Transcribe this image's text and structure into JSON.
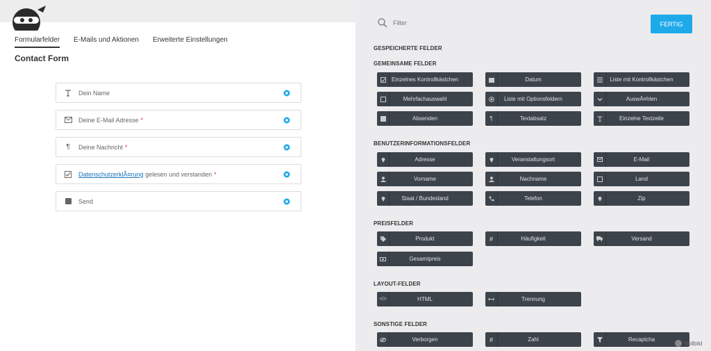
{
  "tabs": [
    "Formularfelder",
    "E-Mails und Aktionen",
    "Erweiterte Einstellungen"
  ],
  "form_title": "Contact Form",
  "fields": [
    {
      "label": "Dein Name",
      "icon": "text-icon",
      "required": ""
    },
    {
      "label": "Deine E-Mail Adresse",
      "icon": "envelope-icon",
      "required": "*"
    },
    {
      "label": "Deine Nachricht",
      "icon": "paragraph-icon",
      "required": "*"
    },
    {
      "link": "DatenschutzerklÃ¤rung",
      "label": " gelesen und verstanden",
      "icon": "checkbox-icon",
      "required": "*"
    },
    {
      "label": "Send",
      "icon": "square-icon",
      "required": ""
    }
  ],
  "filter_placeholder": "Filter",
  "done_label": "FERTIG",
  "sections": {
    "saved": "GESPEICHERTE FELDER",
    "common": "GEMEINSAME FELDER",
    "userinfo": "BENUTZERINFORMATIONSFELDER",
    "pricing": "PREISFELDER",
    "layout": "LAYOUT-FELDER",
    "misc": "SONSTIGE FELDER"
  },
  "common_fields": [
    "Einzelnes Kontrollkästchen",
    "Datum",
    "Liste mit Kontrollkästchen",
    "Mehrfachauswahl",
    "Liste mit Optionsfeldern",
    "AuswÃ¤hlen",
    "Absenden",
    "Textabsatz",
    "Einzelne Textzeile"
  ],
  "userinfo_fields": [
    "Adresse",
    "Veranstaltungsort",
    "E-Mail",
    "Vorname",
    "Nachname",
    "Land",
    "Staat / Bundesland",
    "Telefon",
    "Zip"
  ],
  "pricing_fields": [
    "Produkt",
    "Häufigkeit",
    "Versand",
    "Gesamtpreis"
  ],
  "layout_fields": [
    "HTML",
    "Trennung"
  ],
  "misc_fields": [
    "Verborgen",
    "Zahl",
    "Recaptcha"
  ],
  "fullscreen_label": "Vollbild",
  "colors": {
    "accent": "#1ea9ea",
    "button_bg": "#3d434b",
    "required": "#d9304c",
    "link": "#1a73b8"
  }
}
